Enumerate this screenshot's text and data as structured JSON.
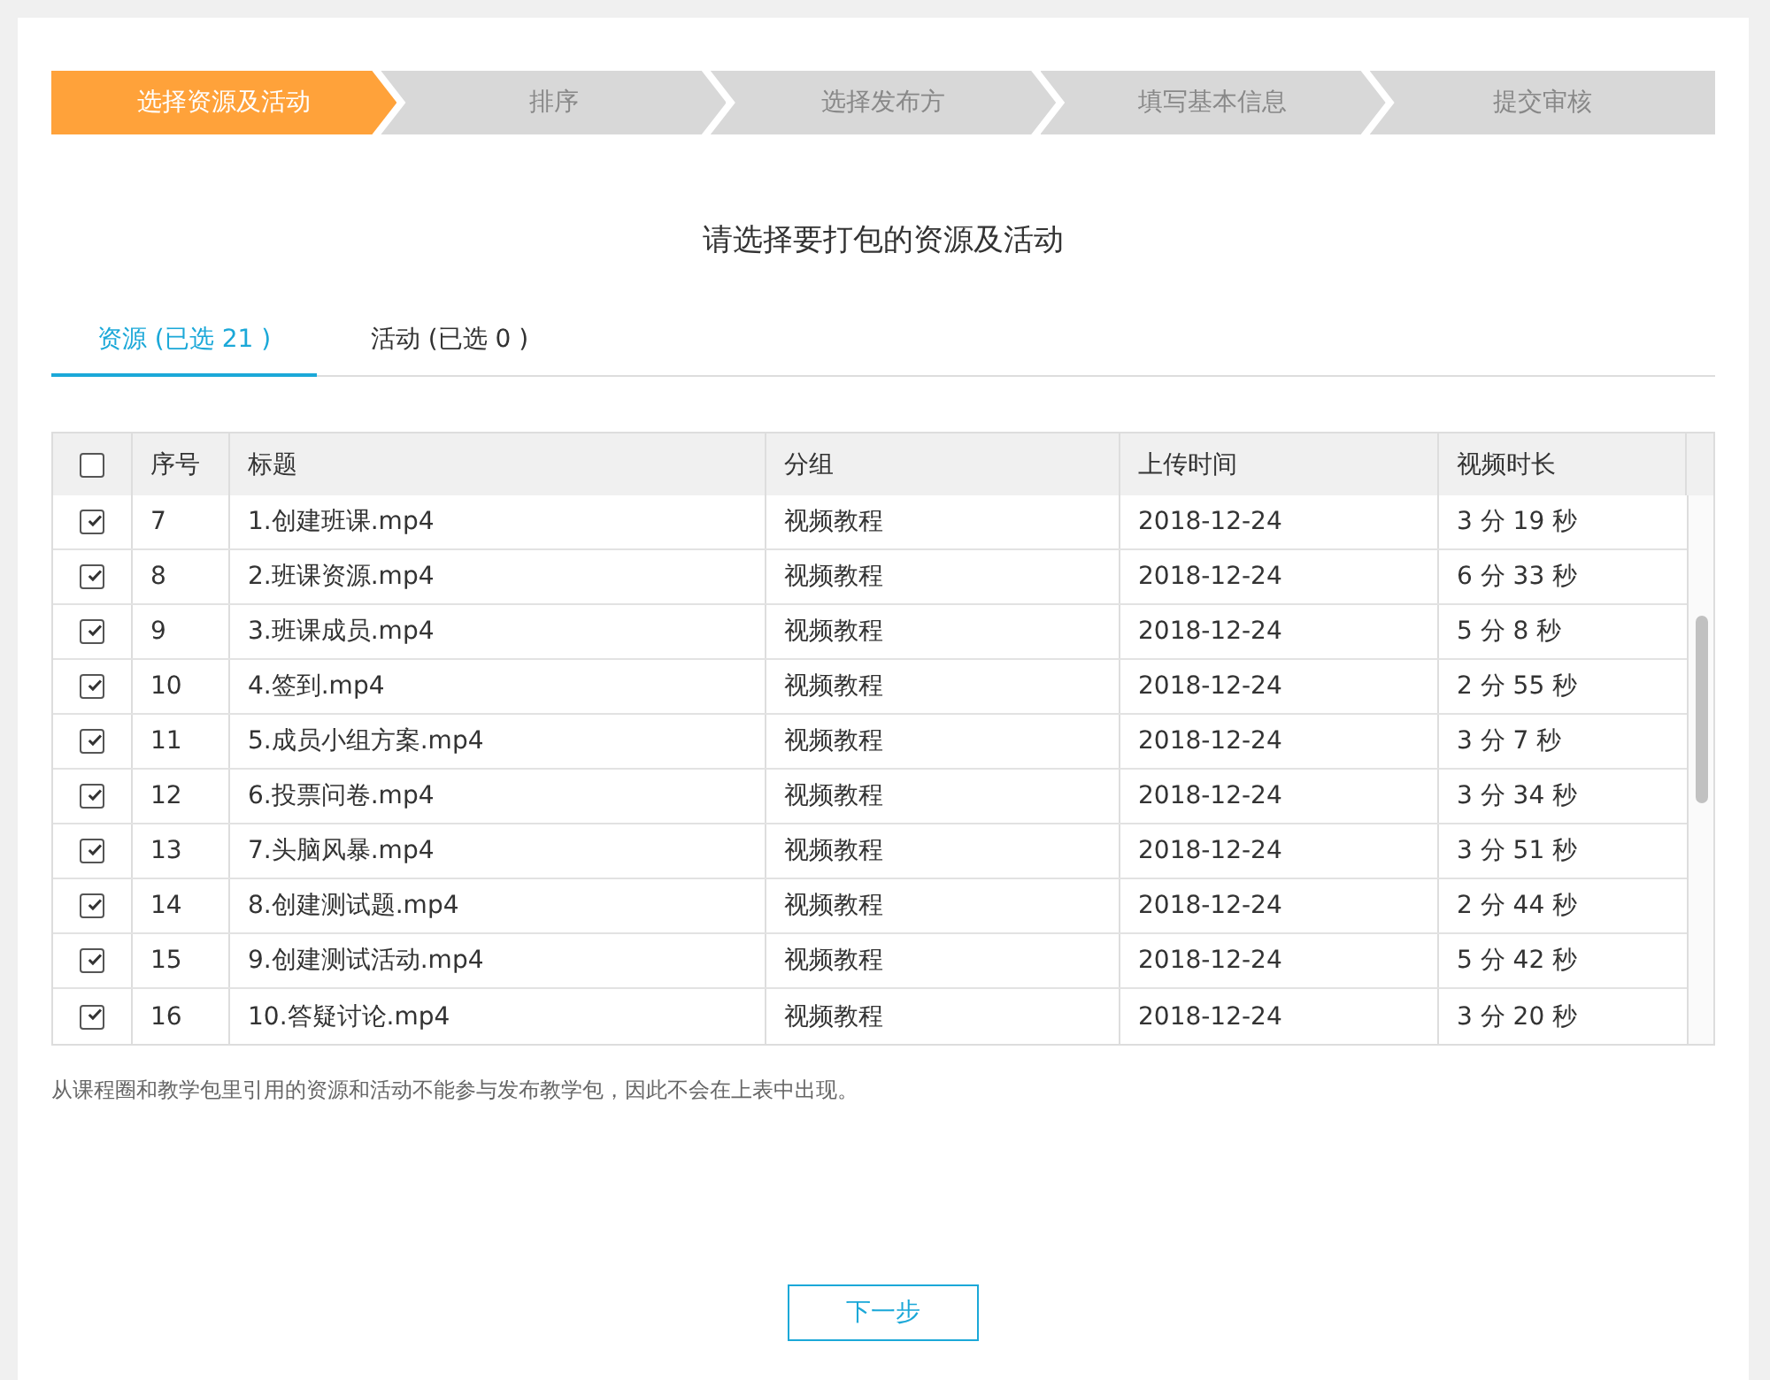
{
  "steps": [
    {
      "label": "选择资源及活动",
      "selected": true
    },
    {
      "label": "排序",
      "selected": false
    },
    {
      "label": "选择发布方",
      "selected": false
    },
    {
      "label": "填写基本信息",
      "selected": false
    },
    {
      "label": "提交审核",
      "selected": false
    }
  ],
  "heading": "请选择要打包的资源及活动",
  "tabs": [
    {
      "label": "资源 (已选 21 )",
      "selected": true
    },
    {
      "label": "活动 (已选 0 )",
      "selected": false
    }
  ],
  "table": {
    "select_all": {
      "checked": false
    },
    "columns": [
      "序号",
      "标题",
      "分组",
      "上传时间",
      "视频时长"
    ],
    "rows": [
      {
        "checked": true,
        "cells": [
          "7",
          "1.创建班课.mp4",
          "视频教程",
          "2018-12-24",
          "3 分 19 秒"
        ]
      },
      {
        "checked": true,
        "cells": [
          "8",
          "2.班课资源.mp4",
          "视频教程",
          "2018-12-24",
          "6 分 33 秒"
        ]
      },
      {
        "checked": true,
        "cells": [
          "9",
          "3.班课成员.mp4",
          "视频教程",
          "2018-12-24",
          "5 分 8 秒"
        ]
      },
      {
        "checked": true,
        "cells": [
          "10",
          "4.签到.mp4",
          "视频教程",
          "2018-12-24",
          "2 分 55 秒"
        ]
      },
      {
        "checked": true,
        "cells": [
          "11",
          "5.成员小组方案.mp4",
          "视频教程",
          "2018-12-24",
          "3 分 7 秒"
        ]
      },
      {
        "checked": true,
        "cells": [
          "12",
          "6.投票问卷.mp4",
          "视频教程",
          "2018-12-24",
          "3 分 34 秒"
        ]
      },
      {
        "checked": true,
        "cells": [
          "13",
          "7.头脑风暴.mp4",
          "视频教程",
          "2018-12-24",
          "3 分 51 秒"
        ]
      },
      {
        "checked": true,
        "cells": [
          "14",
          "8.创建测试题.mp4",
          "视频教程",
          "2018-12-24",
          "2 分 44 秒"
        ]
      },
      {
        "checked": true,
        "cells": [
          "15",
          "9.创建测试活动.mp4",
          "视频教程",
          "2018-12-24",
          "5 分 42 秒"
        ]
      },
      {
        "checked": true,
        "cells": [
          "16",
          "10.答疑讨论.mp4",
          "视频教程",
          "2018-12-24",
          "3 分 20 秒"
        ]
      }
    ]
  },
  "note": "从课程圈和教学包里引用的资源和活动不能参与发布教学包，因此不会在上表中出现。",
  "next_button": "下一步"
}
